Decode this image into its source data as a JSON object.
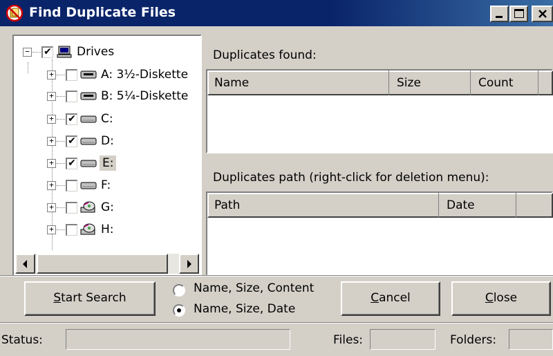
{
  "window": {
    "title": "Find Duplicate Files",
    "caption_buttons": [
      "minimize-icon",
      "maximize-icon",
      "close-icon"
    ]
  },
  "tree": {
    "root": {
      "label": "Drives",
      "checked": true,
      "expander": "−"
    },
    "items": [
      {
        "label": "A: 3½-Diskette",
        "checked": false,
        "expander": "+",
        "icon": "floppy-drive-icon"
      },
      {
        "label": "B: 5¼-Diskette",
        "checked": false,
        "expander": "+",
        "icon": "floppy-drive-icon"
      },
      {
        "label": "C:",
        "checked": true,
        "expander": "+",
        "icon": "hard-drive-icon"
      },
      {
        "label": "D:",
        "checked": true,
        "expander": "+",
        "icon": "hard-drive-icon"
      },
      {
        "label": "E:",
        "checked": true,
        "expander": "+",
        "icon": "hard-drive-icon",
        "selected": true
      },
      {
        "label": "F:",
        "checked": false,
        "expander": "+",
        "icon": "hard-drive-icon"
      },
      {
        "label": "G:",
        "checked": false,
        "expander": "+",
        "icon": "cd-drive-icon"
      },
      {
        "label": "H:",
        "checked": false,
        "expander": "+",
        "icon": "cd-drive-icon"
      }
    ]
  },
  "duplicates": {
    "label": "Duplicates found:",
    "columns": [
      "Name",
      "Size",
      "Count"
    ]
  },
  "paths": {
    "label": "Duplicates path (right-click for deletion menu):",
    "columns": [
      "Path",
      "Date"
    ]
  },
  "actions": {
    "start": {
      "accel": "S",
      "rest": "tart Search"
    },
    "cancel": {
      "accel": "C",
      "rest": "ancel"
    },
    "close": {
      "accel": "C",
      "rest": "lose"
    }
  },
  "compare_mode": {
    "options": [
      "Name, Size, Content",
      "Name, Size, Date"
    ],
    "selected": 1
  },
  "statusbar": {
    "status_label": "Status:",
    "status_value": "",
    "files_label": "Files:",
    "files_value": "",
    "folders_label": "Folders:",
    "folders_value": ""
  },
  "colors": {
    "titlebar": "#0a246a",
    "face": "#d4d0c8"
  }
}
